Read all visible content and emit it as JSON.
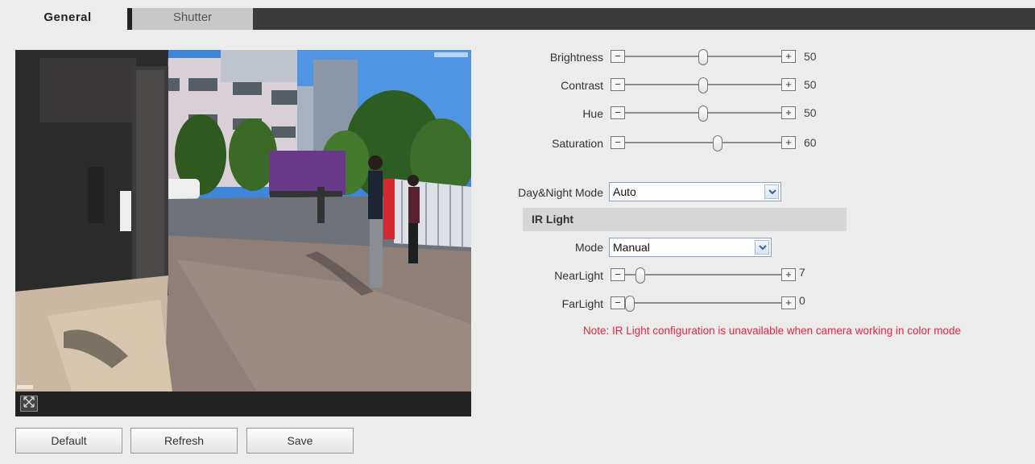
{
  "tabs": [
    {
      "label": "General"
    },
    {
      "label": "Shutter"
    }
  ],
  "preview": {
    "fullscreen_icon": "fullscreen-icon"
  },
  "sliders": {
    "brightness": {
      "label": "Brightness",
      "value": "50",
      "fraction": 0.5
    },
    "contrast": {
      "label": "Contrast",
      "value": "50",
      "fraction": 0.5
    },
    "hue": {
      "label": "Hue",
      "value": "50",
      "fraction": 0.5
    },
    "saturation": {
      "label": "Saturation",
      "value": "60",
      "fraction": 0.6
    },
    "nearlight": {
      "label": "NearLight",
      "value": "7",
      "fraction": 0.07
    },
    "farlight": {
      "label": "FarLight",
      "value": "0",
      "fraction": 0.0
    }
  },
  "daynight": {
    "label": "Day&Night Mode",
    "value": "Auto"
  },
  "ir": {
    "section_title": "IR Light",
    "mode_label": "Mode",
    "mode_value": "Manual"
  },
  "note": "Note: IR Light configuration is unavailable when camera working in color mode",
  "buttons": {
    "default": "Default",
    "refresh": "Refresh",
    "save": "Save"
  },
  "colors": {
    "note": "#e8263d",
    "tabbar": "#3a3a3a"
  }
}
